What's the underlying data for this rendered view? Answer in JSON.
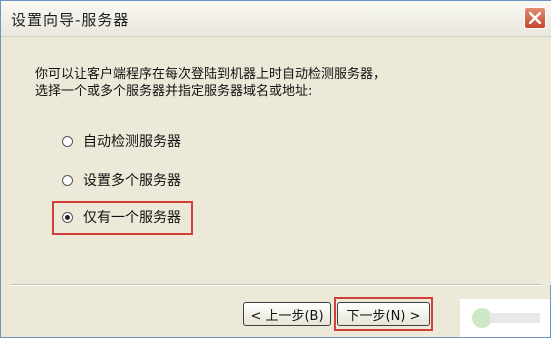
{
  "window": {
    "title": "设置向导-服务器"
  },
  "main": {
    "description": "你可以让客户端程序在每次登陆到机器上时自动检测服务器，\n选择一个或多个服务器并指定服务器域名或地址:",
    "options": [
      {
        "label": "自动检测服务器",
        "checked": false
      },
      {
        "label": "设置多个服务器",
        "checked": false
      },
      {
        "label": "仅有一个服务器",
        "checked": true
      }
    ]
  },
  "footer": {
    "back_label": "< 上一步(B)",
    "next_label": "下一步(N) >"
  },
  "colors": {
    "highlight": "#d33f3a",
    "close_button": "#c5462d",
    "dialog_bg": "#ece9d8"
  }
}
